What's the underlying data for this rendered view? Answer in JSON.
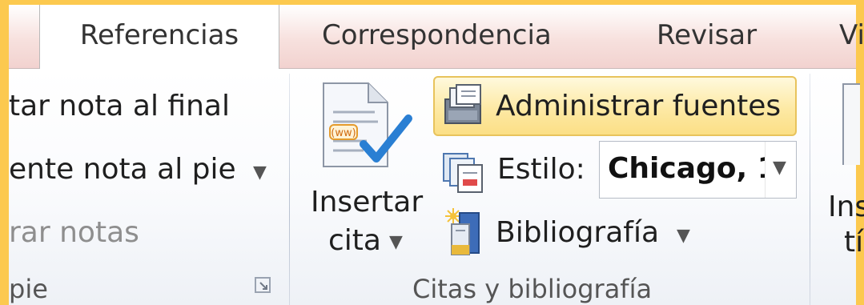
{
  "tabs": [
    {
      "label": "Referencias",
      "active": true
    },
    {
      "label": "Correspondencia",
      "active": false
    },
    {
      "label": "Revisar",
      "active": false
    },
    {
      "label": "Vi",
      "active": false
    }
  ],
  "footnotes_group": {
    "insert_endnote_label": "tar nota al final",
    "next_footnote_label": "ente nota al pie",
    "show_notes_label": "rar notas",
    "group_label": "pie"
  },
  "citations_group": {
    "insert_citation_line1": "Insertar",
    "insert_citation_line2": "cita",
    "manage_sources_label": "Administrar fuentes",
    "style_label": "Estilo:",
    "style_value": "Chicago, 1",
    "bibliography_label": "Bibliografía",
    "group_label": "Citas y bibliografía"
  },
  "next_group": {
    "line1": "Ins",
    "line2": "tí"
  },
  "colors": {
    "highlight_frame": "#fcc94f",
    "tab_strip": "#f2d2cf",
    "hover_button": "#fde9a4"
  },
  "icons": [
    "insert-citation-icon",
    "manage-sources-icon",
    "style-icon",
    "bibliography-icon",
    "dialog-launcher-icon"
  ]
}
